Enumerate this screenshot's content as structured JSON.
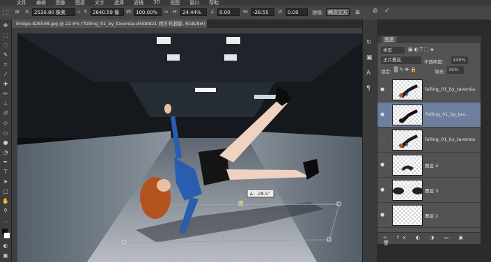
{
  "menubar": {
    "items": [
      "文件",
      "编辑",
      "图像",
      "图层",
      "文字",
      "选择",
      "滤镜",
      "3D",
      "视图",
      "窗口",
      "帮助"
    ]
  },
  "options": {
    "x_value": "2530.80 像素",
    "y_label": "Y:",
    "y_value": "2640.59 像",
    "w_label": "W:",
    "w_value": "100.00%",
    "h_label": "H:",
    "h_value": "24.44%",
    "angle_value": "0.00",
    "hskew_label": "H:",
    "hskew_value": "-28.55",
    "vskew_label": "V:",
    "vskew_value": "0.00",
    "interp_label": "插值:",
    "interp_value": "两次立方",
    "cancel_icon": "cancel-transform-icon",
    "commit_icon": "commit-transform-icon"
  },
  "document": {
    "tab_title": "bridge-828598.jpg @ 22.6% ('falling_01_by_taversia-d4kbbtz1 拷贝'的投影, RGB/8#) *",
    "angle_readout": "∠: -28.5°"
  },
  "layers": {
    "tab_label": "图层",
    "filter_kind": "类型",
    "blend_mode": "正片叠底",
    "opacity_label": "不透明度:",
    "opacity_value": "100%",
    "lock_label": "锁定:",
    "fill_label": "填充:",
    "fill_value": "35%",
    "rows": [
      {
        "name": "falling_01_by_taversia..."
      },
      {
        "name": "'falling_01_by_tav..."
      },
      {
        "name": "falling_01_by_taversia..."
      },
      {
        "name": "图层 4"
      },
      {
        "name": "图层 3"
      },
      {
        "name": "图层 2"
      }
    ]
  },
  "colors": {
    "accent": "#6a7fa3",
    "panel_bg": "#535353",
    "selected_row": "#6e7f9e"
  }
}
